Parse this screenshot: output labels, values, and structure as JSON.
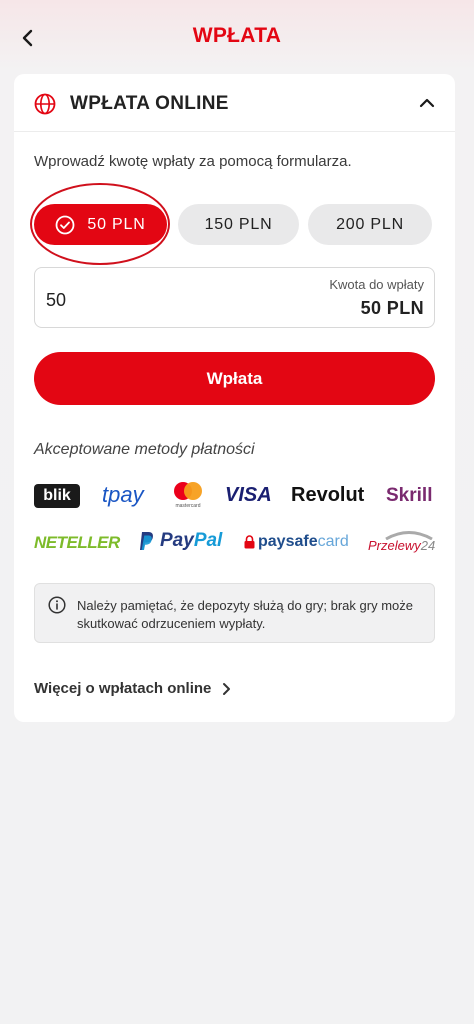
{
  "header": {
    "title": "WPŁATA",
    "back_icon": "chevron-left-icon"
  },
  "section": {
    "title": "WPŁATA ONLINE",
    "icon": "globe-icon",
    "collapse_icon": "chevron-up-icon"
  },
  "instruction": "Wprowadź kwotę wpłaty za pomocą formularza.",
  "amount_options": [
    {
      "label": "50 PLN",
      "selected": true
    },
    {
      "label": "150 PLN",
      "selected": false
    },
    {
      "label": "200 PLN",
      "selected": false
    }
  ],
  "amount_field": {
    "value": "50",
    "label": "Kwota do wpłaty",
    "total": "50 PLN"
  },
  "submit_label": "Wpłata",
  "methods": {
    "title": "Akceptowane metody płatności",
    "logos": {
      "blik": "blik",
      "tpay": "tpay",
      "mastercard": "mastercard",
      "visa": "VISA",
      "revolut": "Revolut",
      "skrill": "Skrill",
      "neteller": "NETELLER",
      "paypal_a": "Pay",
      "paypal_b": "Pal",
      "paysafe_a": "paysafe",
      "paysafe_b": "card",
      "p24_a": "Przelewy",
      "p24_b": "24"
    }
  },
  "info": {
    "text": "Należy pamiętać, że depozyty służą do gry; brak gry może skutkować odrzuceniem wypłaty.",
    "icon": "info-icon"
  },
  "more_link": "Więcej o wpłatach online",
  "colors": {
    "accent": "#e30613",
    "background": "#f2f2f3",
    "card": "#ffffff"
  }
}
